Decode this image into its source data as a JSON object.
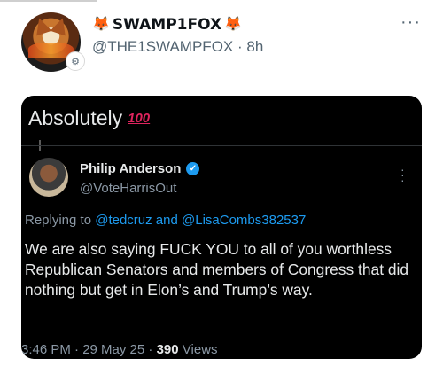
{
  "post": {
    "display_name": "SWAMP1FOX",
    "name_emoji_left": "🦊",
    "name_emoji_right": "🦊",
    "handle": "@THE1SWAMPFOX",
    "separator": "·",
    "time": "8h",
    "more_label": "···",
    "badge_icon": "gear-icon"
  },
  "screenshot": {
    "caption": "Absolutely",
    "caption_emoji": "100",
    "quoted": {
      "name": "Philip Anderson",
      "handle": "@VoteHarrisOut",
      "verified": true,
      "replying_prefix": "Replying to",
      "replying_mentions": "@tedcruz and @LisaCombs382537",
      "text": "We are also saying FUCK YOU to all of you worthless Republican Senators and members of Congress that did nothing but get in Elon’s and Trump’s way.",
      "timestamp": "3:46 PM · 29 May 25 ·",
      "views_count": "390",
      "views_label": "Views"
    }
  },
  "colors": {
    "accent": "#1d9bf0",
    "dark_bg": "#000000",
    "muted": "#8b98a5"
  }
}
